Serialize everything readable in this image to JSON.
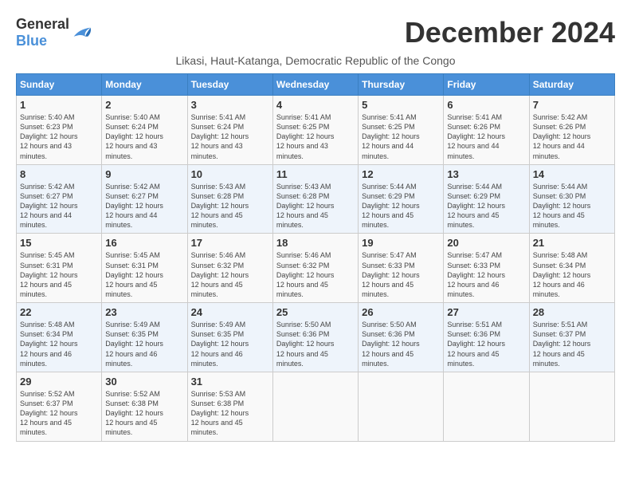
{
  "header": {
    "logo_general": "General",
    "logo_blue": "Blue",
    "month_title": "December 2024",
    "subtitle": "Likasi, Haut-Katanga, Democratic Republic of the Congo"
  },
  "days_of_week": [
    "Sunday",
    "Monday",
    "Tuesday",
    "Wednesday",
    "Thursday",
    "Friday",
    "Saturday"
  ],
  "weeks": [
    [
      {
        "day": "1",
        "sunrise": "5:40 AM",
        "sunset": "6:23 PM",
        "daylight": "12 hours and 43 minutes."
      },
      {
        "day": "2",
        "sunrise": "5:40 AM",
        "sunset": "6:24 PM",
        "daylight": "12 hours and 43 minutes."
      },
      {
        "day": "3",
        "sunrise": "5:41 AM",
        "sunset": "6:24 PM",
        "daylight": "12 hours and 43 minutes."
      },
      {
        "day": "4",
        "sunrise": "5:41 AM",
        "sunset": "6:25 PM",
        "daylight": "12 hours and 43 minutes."
      },
      {
        "day": "5",
        "sunrise": "5:41 AM",
        "sunset": "6:25 PM",
        "daylight": "12 hours and 44 minutes."
      },
      {
        "day": "6",
        "sunrise": "5:41 AM",
        "sunset": "6:26 PM",
        "daylight": "12 hours and 44 minutes."
      },
      {
        "day": "7",
        "sunrise": "5:42 AM",
        "sunset": "6:26 PM",
        "daylight": "12 hours and 44 minutes."
      }
    ],
    [
      {
        "day": "8",
        "sunrise": "5:42 AM",
        "sunset": "6:27 PM",
        "daylight": "12 hours and 44 minutes."
      },
      {
        "day": "9",
        "sunrise": "5:42 AM",
        "sunset": "6:27 PM",
        "daylight": "12 hours and 44 minutes."
      },
      {
        "day": "10",
        "sunrise": "5:43 AM",
        "sunset": "6:28 PM",
        "daylight": "12 hours and 45 minutes."
      },
      {
        "day": "11",
        "sunrise": "5:43 AM",
        "sunset": "6:28 PM",
        "daylight": "12 hours and 45 minutes."
      },
      {
        "day": "12",
        "sunrise": "5:44 AM",
        "sunset": "6:29 PM",
        "daylight": "12 hours and 45 minutes."
      },
      {
        "day": "13",
        "sunrise": "5:44 AM",
        "sunset": "6:29 PM",
        "daylight": "12 hours and 45 minutes."
      },
      {
        "day": "14",
        "sunrise": "5:44 AM",
        "sunset": "6:30 PM",
        "daylight": "12 hours and 45 minutes."
      }
    ],
    [
      {
        "day": "15",
        "sunrise": "5:45 AM",
        "sunset": "6:31 PM",
        "daylight": "12 hours and 45 minutes."
      },
      {
        "day": "16",
        "sunrise": "5:45 AM",
        "sunset": "6:31 PM",
        "daylight": "12 hours and 45 minutes."
      },
      {
        "day": "17",
        "sunrise": "5:46 AM",
        "sunset": "6:32 PM",
        "daylight": "12 hours and 45 minutes."
      },
      {
        "day": "18",
        "sunrise": "5:46 AM",
        "sunset": "6:32 PM",
        "daylight": "12 hours and 45 minutes."
      },
      {
        "day": "19",
        "sunrise": "5:47 AM",
        "sunset": "6:33 PM",
        "daylight": "12 hours and 45 minutes."
      },
      {
        "day": "20",
        "sunrise": "5:47 AM",
        "sunset": "6:33 PM",
        "daylight": "12 hours and 46 minutes."
      },
      {
        "day": "21",
        "sunrise": "5:48 AM",
        "sunset": "6:34 PM",
        "daylight": "12 hours and 46 minutes."
      }
    ],
    [
      {
        "day": "22",
        "sunrise": "5:48 AM",
        "sunset": "6:34 PM",
        "daylight": "12 hours and 46 minutes."
      },
      {
        "day": "23",
        "sunrise": "5:49 AM",
        "sunset": "6:35 PM",
        "daylight": "12 hours and 46 minutes."
      },
      {
        "day": "24",
        "sunrise": "5:49 AM",
        "sunset": "6:35 PM",
        "daylight": "12 hours and 46 minutes."
      },
      {
        "day": "25",
        "sunrise": "5:50 AM",
        "sunset": "6:36 PM",
        "daylight": "12 hours and 45 minutes."
      },
      {
        "day": "26",
        "sunrise": "5:50 AM",
        "sunset": "6:36 PM",
        "daylight": "12 hours and 45 minutes."
      },
      {
        "day": "27",
        "sunrise": "5:51 AM",
        "sunset": "6:36 PM",
        "daylight": "12 hours and 45 minutes."
      },
      {
        "day": "28",
        "sunrise": "5:51 AM",
        "sunset": "6:37 PM",
        "daylight": "12 hours and 45 minutes."
      }
    ],
    [
      {
        "day": "29",
        "sunrise": "5:52 AM",
        "sunset": "6:37 PM",
        "daylight": "12 hours and 45 minutes."
      },
      {
        "day": "30",
        "sunrise": "5:52 AM",
        "sunset": "6:38 PM",
        "daylight": "12 hours and 45 minutes."
      },
      {
        "day": "31",
        "sunrise": "5:53 AM",
        "sunset": "6:38 PM",
        "daylight": "12 hours and 45 minutes."
      },
      null,
      null,
      null,
      null
    ]
  ],
  "labels": {
    "sunrise_prefix": "Sunrise: ",
    "sunset_prefix": "Sunset: ",
    "daylight_prefix": "Daylight: 12 hours"
  }
}
